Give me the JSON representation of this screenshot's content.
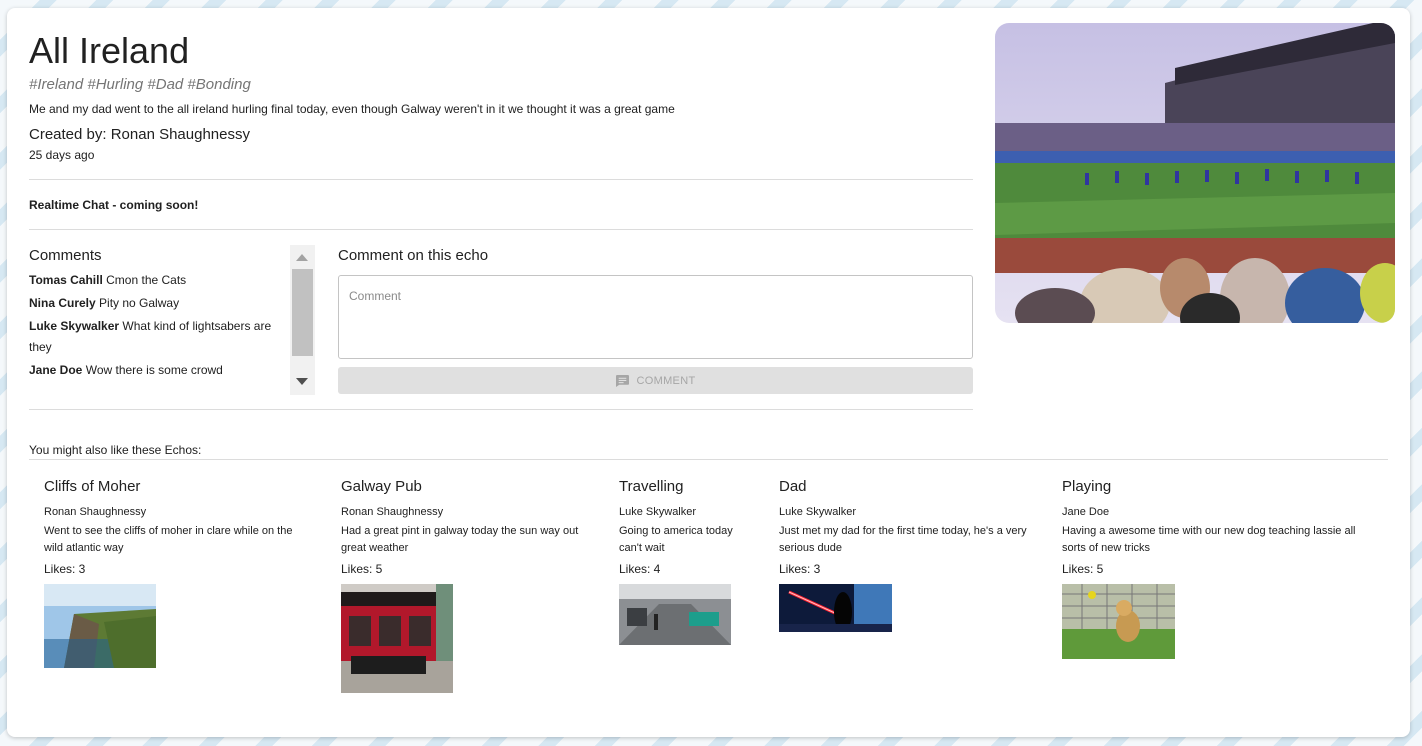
{
  "echo": {
    "title": "All Ireland",
    "tags": "#Ireland #Hurling #Dad #Bonding",
    "description": "Me and my dad went to the all ireland hurling final today, even though Galway weren't in it we thought it was a great game",
    "created_by": "Created by: Ronan Shaughnessy",
    "time_ago": "25 days ago"
  },
  "realtime_chat": "Realtime Chat - coming soon!",
  "comments": {
    "title": "Comments",
    "items": [
      {
        "author": "Tomas Cahill",
        "text": "Cmon the Cats"
      },
      {
        "author": "Nina Curely",
        "text": "Pity no Galway"
      },
      {
        "author": "Luke Skywalker",
        "text": "What kind of lightsabers are they"
      },
      {
        "author": "Jane Doe",
        "text": "Wow there is some crowd"
      }
    ]
  },
  "compose": {
    "title": "Comment on this echo",
    "placeholder": "Comment",
    "button_label": "COMMENT",
    "button_icon": "chat-icon"
  },
  "hero_image": {
    "icon": "stadium-photo"
  },
  "also_like": {
    "label": "You might also like these Echos:",
    "items": [
      {
        "title": "Cliffs of Moher",
        "author": "Ronan Shaughnessy",
        "description": "Went to see the cliffs of moher in clare while on the wild atlantic way",
        "likes": "Likes: 3"
      },
      {
        "title": "Galway Pub",
        "author": "Ronan Shaughnessy",
        "description": "Had a great pint in galway today the sun way out great weather",
        "likes": "Likes: 5"
      },
      {
        "title": "Travelling",
        "author": "Luke Skywalker",
        "description": "Going to america today can't wait",
        "likes": "Likes: 4"
      },
      {
        "title": "Dad",
        "author": "Luke Skywalker",
        "description": "Just met my dad for the first time today, he's a very serious dude",
        "likes": "Likes: 3"
      },
      {
        "title": "Playing",
        "author": "Jane Doe",
        "description": "Having a awesome time with our new dog teaching lassie all sorts of new tricks",
        "likes": "Likes: 5"
      }
    ]
  }
}
